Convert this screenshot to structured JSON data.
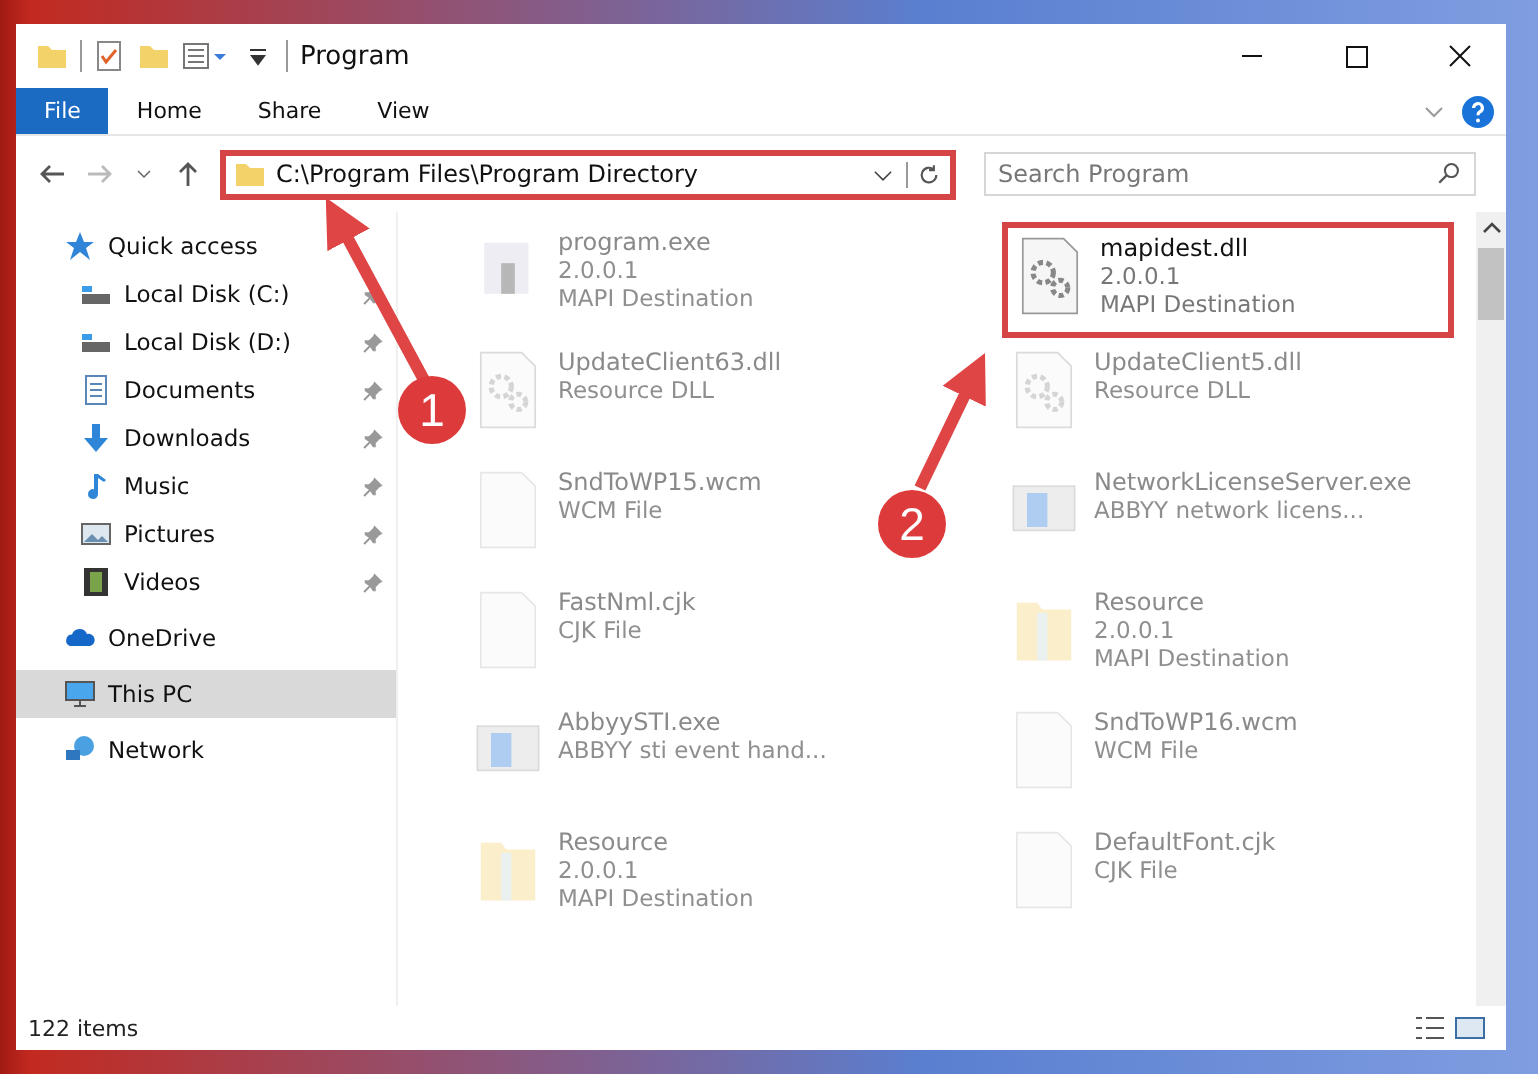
{
  "window": {
    "title": "Program"
  },
  "ribbon": {
    "tabs": [
      {
        "label": "File",
        "selected": true
      },
      {
        "label": "Home",
        "selected": false
      },
      {
        "label": "Share",
        "selected": false
      },
      {
        "label": "View",
        "selected": false
      }
    ]
  },
  "address_bar": {
    "path": "C:\\Program Files\\Program Directory",
    "highlighted": true
  },
  "search": {
    "placeholder": "Search Program"
  },
  "sidebar": {
    "items": [
      {
        "label": "Quick access",
        "kind": "star",
        "selected": false,
        "children": [
          {
            "label": "Local Disk (C:)",
            "kind": "disk",
            "pinned": true
          },
          {
            "label": "Local Disk (D:)",
            "kind": "disk",
            "pinned": true
          },
          {
            "label": "Documents",
            "kind": "doc",
            "pinned": true
          },
          {
            "label": "Downloads",
            "kind": "download",
            "pinned": true
          },
          {
            "label": "Music",
            "kind": "music",
            "pinned": true
          },
          {
            "label": "Pictures",
            "kind": "picture",
            "pinned": true
          },
          {
            "label": "Videos",
            "kind": "video",
            "pinned": true
          }
        ]
      },
      {
        "label": "OneDrive",
        "kind": "cloud",
        "selected": false
      },
      {
        "label": "This PC",
        "kind": "pc",
        "selected": true
      },
      {
        "label": "Network",
        "kind": "network",
        "selected": false
      }
    ]
  },
  "files": [
    {
      "name": "program.exe",
      "details": [
        "2.0.0.1",
        "MAPI Destination"
      ],
      "kind": "app",
      "faded": true,
      "highlighted": false
    },
    {
      "name": "mapidest.dll",
      "details": [
        "2.0.0.1",
        "MAPI Destination"
      ],
      "kind": "gears",
      "faded": false,
      "highlighted": true
    },
    {
      "name": "UpdateClient63.dll",
      "details": [
        "Resource DLL"
      ],
      "kind": "gears",
      "faded": true,
      "highlighted": false
    },
    {
      "name": "UpdateClient5.dll",
      "details": [
        "Resource DLL"
      ],
      "kind": "gears",
      "faded": true,
      "highlighted": false
    },
    {
      "name": "SndToWP15.wcm",
      "details": [
        "WCM File"
      ],
      "kind": "file",
      "faded": true,
      "highlighted": false
    },
    {
      "name": "NetworkLicenseServer.exe",
      "details": [
        "ABBYY network licens..."
      ],
      "kind": "window",
      "faded": true,
      "highlighted": false
    },
    {
      "name": "FastNml.cjk",
      "details": [
        "CJK File"
      ],
      "kind": "file",
      "faded": true,
      "highlighted": false
    },
    {
      "name": "Resource",
      "details": [
        "2.0.0.1",
        "MAPI Destination"
      ],
      "kind": "folder",
      "faded": true,
      "highlighted": false
    },
    {
      "name": "AbbyySTI.exe",
      "details": [
        "ABBYY sti event hand..."
      ],
      "kind": "window",
      "faded": true,
      "highlighted": false
    },
    {
      "name": "SndToWP16.wcm",
      "details": [
        "WCM File"
      ],
      "kind": "file",
      "faded": true,
      "highlighted": false
    },
    {
      "name": "Resource",
      "details": [
        "2.0.0.1",
        "MAPI Destination"
      ],
      "kind": "folder",
      "faded": true,
      "highlighted": false
    },
    {
      "name": "DefaultFont.cjk",
      "details": [
        "CJK File"
      ],
      "kind": "file",
      "faded": true,
      "highlighted": false
    }
  ],
  "status_bar": {
    "count": "122 items"
  },
  "annotations": [
    {
      "number": "1"
    },
    {
      "number": "2"
    }
  ]
}
